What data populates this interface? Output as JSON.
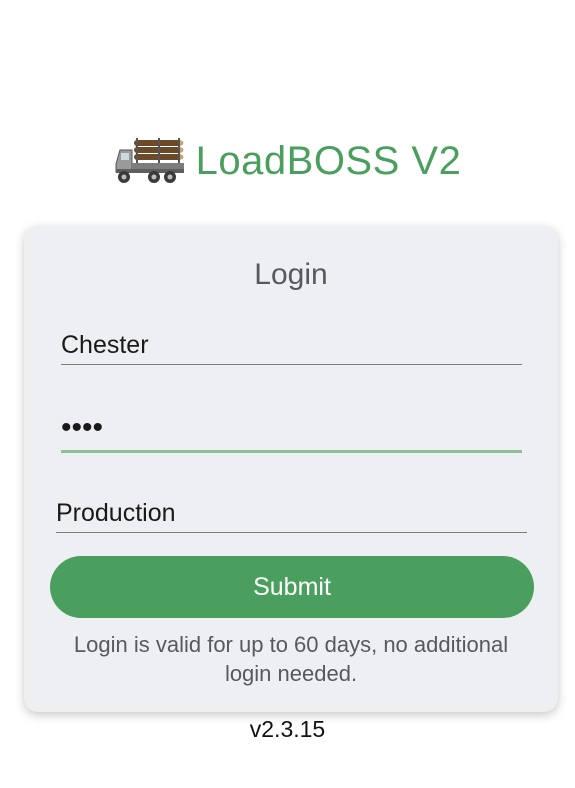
{
  "app": {
    "title": "LoadBOSS V2",
    "logo_icon": "log-truck-icon",
    "brand_color": "#4a9f5e"
  },
  "login": {
    "heading": "Login",
    "username_value": "Chester",
    "password_masked": "••••",
    "environment_value": "Production",
    "submit_label": "Submit",
    "note": "Login is valid for up to 60 days, no additional login needed."
  },
  "version": "v2.3.15"
}
